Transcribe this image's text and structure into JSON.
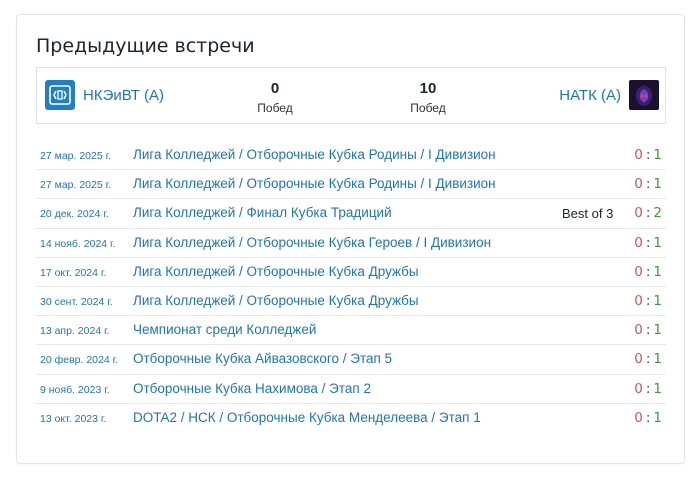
{
  "title": "Предыдущие встречи",
  "summary": {
    "left_team": {
      "name": "НКЭиВТ (А)",
      "logo_icon": "nkeivt-logo-icon"
    },
    "right_team": {
      "name": "НАТК (А)",
      "logo_icon": "natk-logo-icon"
    },
    "left_wins": "0",
    "left_wins_label": "Побед",
    "right_wins": "10",
    "right_wins_label": "Побед"
  },
  "matches": [
    {
      "date": "27 мар. 2025 г.",
      "event": "Лига Колледжей / Отборочные Кубка Родины / I Дивизион",
      "format": "",
      "score_left": "0",
      "score_right": "1"
    },
    {
      "date": "27 мар. 2025 г.",
      "event": "Лига Колледжей / Отборочные Кубка Родины / I Дивизион",
      "format": "",
      "score_left": "0",
      "score_right": "1"
    },
    {
      "date": "20 дек. 2024 г.",
      "event": "Лига Колледжей / Финал Кубка Традиций",
      "format": "Best of 3",
      "score_left": "0",
      "score_right": "2"
    },
    {
      "date": "14 нояб. 2024 г.",
      "event": "Лига Колледжей / Отборочные Кубка Героев / I Дивизион",
      "format": "",
      "score_left": "0",
      "score_right": "1"
    },
    {
      "date": "17 окт. 2024 г.",
      "event": "Лига Колледжей / Отборочные Кубка Дружбы",
      "format": "",
      "score_left": "0",
      "score_right": "1"
    },
    {
      "date": "30 сент. 2024 г.",
      "event": "Лига Колледжей / Отборочные Кубка Дружбы",
      "format": "",
      "score_left": "0",
      "score_right": "1"
    },
    {
      "date": "13 апр. 2024 г.",
      "event": "Чемпионат среди Колледжей",
      "format": "",
      "score_left": "0",
      "score_right": "1"
    },
    {
      "date": "20 февр. 2024 г.",
      "event": "Отборочные Кубка Айвазовского / Этап 5",
      "format": "",
      "score_left": "0",
      "score_right": "1"
    },
    {
      "date": "9 нояб. 2023 г.",
      "event": "Отборочные Кубка Нахимова / Этап 2",
      "format": "",
      "score_left": "0",
      "score_right": "1"
    },
    {
      "date": "13 окт. 2023 г.",
      "event": "DOTA2 / НСК / Отборочные Кубка Менделеева / Этап 1",
      "format": "",
      "score_left": "0",
      "score_right": "1"
    }
  ],
  "colors": {
    "link": "#1d76b8",
    "loss": "#d9534f",
    "win": "#3c9a3c"
  }
}
